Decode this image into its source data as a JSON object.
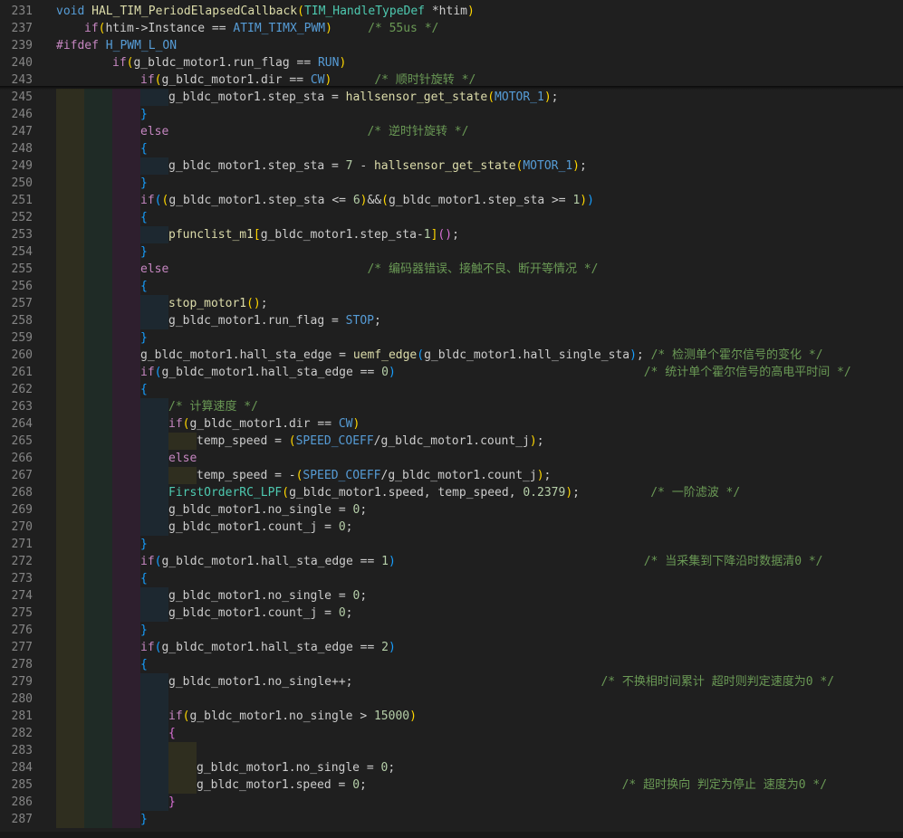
{
  "editor": {
    "language": "C",
    "tokens": [
      {
        "k": "kw",
        "n": "keyword"
      },
      {
        "k": "ctl",
        "n": "control-keyword"
      },
      {
        "k": "typ",
        "n": "type-name"
      },
      {
        "k": "mac",
        "n": "macro"
      },
      {
        "k": "fn",
        "n": "function"
      },
      {
        "k": "num",
        "n": "number"
      },
      {
        "k": "cm",
        "n": "comment"
      },
      {
        "k": "br1",
        "n": "bracket-gold"
      },
      {
        "k": "br2",
        "n": "bracket-purple"
      },
      {
        "k": "br3",
        "n": "bracket-blue"
      }
    ],
    "colors": {
      "background": "#1f1f1f",
      "keyword": "#569cd6",
      "control": "#c586c0",
      "type": "#4ec9b0",
      "function": "#dcdcaa",
      "number": "#b5cea8",
      "comment": "#6a9955",
      "line_number": "#858585"
    },
    "sticky_lines": [
      {
        "num": "231",
        "indent": 0,
        "parts": [
          [
            "kw",
            "void"
          ],
          [
            "txt",
            " "
          ],
          [
            "fn",
            "HAL_TIM_PeriodElapsedCallback"
          ],
          [
            "br1",
            "("
          ],
          [
            "typ",
            "TIM_HandleTypeDef"
          ],
          [
            "txt",
            " *htim"
          ],
          [
            "br1",
            ")"
          ]
        ]
      },
      {
        "num": "237",
        "indent": 1,
        "parts": [
          [
            "ctl",
            "if"
          ],
          [
            "br1",
            "("
          ],
          [
            "txt",
            "htim->Instance == "
          ],
          [
            "mac",
            "ATIM_TIMX_PWM"
          ],
          [
            "br1",
            ")"
          ],
          [
            "txt",
            "     "
          ],
          [
            "cm",
            "/* 55us */"
          ]
        ]
      },
      {
        "num": "239",
        "indent": 0,
        "parts": [
          [
            "ctl",
            "#ifdef"
          ],
          [
            "txt",
            " "
          ],
          [
            "mac",
            "H_PWM_L_ON"
          ]
        ]
      },
      {
        "num": "240",
        "indent": 2,
        "parts": [
          [
            "ctl",
            "if"
          ],
          [
            "br1",
            "("
          ],
          [
            "txt",
            "g_bldc_motor1.run_flag == "
          ],
          [
            "mac",
            "RUN"
          ],
          [
            "br1",
            ")"
          ]
        ]
      },
      {
        "num": "243",
        "indent": 3,
        "parts": [
          [
            "ctl",
            "if"
          ],
          [
            "br1",
            "("
          ],
          [
            "txt",
            "g_bldc_motor1.dir == "
          ],
          [
            "mac",
            "CW"
          ],
          [
            "br1",
            ")"
          ],
          [
            "txt",
            "      "
          ],
          [
            "cm",
            "/* 顺时针旋转 */"
          ]
        ]
      }
    ],
    "lines": [
      {
        "num": "245",
        "indent": 4,
        "parts": [
          [
            "txt",
            "g_bldc_motor1.step_sta = "
          ],
          [
            "fn",
            "hallsensor_get_state"
          ],
          [
            "br1",
            "("
          ],
          [
            "mac",
            "MOTOR_1"
          ],
          [
            "br1",
            ")"
          ],
          [
            "txt",
            ";"
          ]
        ]
      },
      {
        "num": "246",
        "indent": 3,
        "parts": [
          [
            "br3",
            "}"
          ]
        ]
      },
      {
        "num": "247",
        "indent": 3,
        "parts": [
          [
            "ctl",
            "else"
          ],
          [
            "txt",
            "                            "
          ],
          [
            "cm",
            "/* 逆时针旋转 */"
          ]
        ]
      },
      {
        "num": "248",
        "indent": 3,
        "parts": [
          [
            "br3",
            "{"
          ]
        ]
      },
      {
        "num": "249",
        "indent": 4,
        "parts": [
          [
            "txt",
            "g_bldc_motor1.step_sta = "
          ],
          [
            "num",
            "7"
          ],
          [
            "txt",
            " - "
          ],
          [
            "fn",
            "hallsensor_get_state"
          ],
          [
            "br1",
            "("
          ],
          [
            "mac",
            "MOTOR_1"
          ],
          [
            "br1",
            ")"
          ],
          [
            "txt",
            ";"
          ]
        ]
      },
      {
        "num": "250",
        "indent": 3,
        "parts": [
          [
            "br3",
            "}"
          ]
        ]
      },
      {
        "num": "251",
        "indent": 3,
        "parts": [
          [
            "ctl",
            "if"
          ],
          [
            "br3",
            "("
          ],
          [
            "br1",
            "("
          ],
          [
            "txt",
            "g_bldc_motor1.step_sta <= "
          ],
          [
            "num",
            "6"
          ],
          [
            "br1",
            ")"
          ],
          [
            "txt",
            "&&"
          ],
          [
            "br1",
            "("
          ],
          [
            "txt",
            "g_bldc_motor1.step_sta >= "
          ],
          [
            "num",
            "1"
          ],
          [
            "br1",
            ")"
          ],
          [
            "br3",
            ")"
          ]
        ]
      },
      {
        "num": "252",
        "indent": 3,
        "parts": [
          [
            "br3",
            "{"
          ]
        ]
      },
      {
        "num": "253",
        "indent": 4,
        "parts": [
          [
            "fn",
            "pfunclist_m1"
          ],
          [
            "br1",
            "["
          ],
          [
            "txt",
            "g_bldc_motor1.step_sta-"
          ],
          [
            "num",
            "1"
          ],
          [
            "br1",
            "]"
          ],
          [
            "br2",
            "()"
          ],
          [
            "txt",
            ";"
          ]
        ]
      },
      {
        "num": "254",
        "indent": 3,
        "parts": [
          [
            "br3",
            "}"
          ]
        ]
      },
      {
        "num": "255",
        "indent": 3,
        "parts": [
          [
            "ctl",
            "else"
          ],
          [
            "txt",
            "                            "
          ],
          [
            "cm",
            "/* 编码器错误、接触不良、断开等情况 */"
          ]
        ]
      },
      {
        "num": "256",
        "indent": 3,
        "parts": [
          [
            "br3",
            "{"
          ]
        ]
      },
      {
        "num": "257",
        "indent": 4,
        "parts": [
          [
            "fn",
            "stop_motor1"
          ],
          [
            "br1",
            "()"
          ],
          [
            "txt",
            ";"
          ]
        ]
      },
      {
        "num": "258",
        "indent": 4,
        "parts": [
          [
            "txt",
            "g_bldc_motor1.run_flag = "
          ],
          [
            "mac",
            "STOP"
          ],
          [
            "txt",
            ";"
          ]
        ]
      },
      {
        "num": "259",
        "indent": 3,
        "parts": [
          [
            "br3",
            "}"
          ]
        ]
      },
      {
        "num": "260",
        "indent": 3,
        "parts": [
          [
            "txt",
            "g_bldc_motor1.hall_sta_edge = "
          ],
          [
            "fn",
            "uemf_edge"
          ],
          [
            "br3",
            "("
          ],
          [
            "txt",
            "g_bldc_motor1.hall_single_sta"
          ],
          [
            "br3",
            ")"
          ],
          [
            "txt",
            "; "
          ],
          [
            "cm",
            "/* 检测单个霍尔信号的变化 */"
          ]
        ]
      },
      {
        "num": "261",
        "indent": 3,
        "parts": [
          [
            "ctl",
            "if"
          ],
          [
            "br3",
            "("
          ],
          [
            "txt",
            "g_bldc_motor1.hall_sta_edge == "
          ],
          [
            "num",
            "0"
          ],
          [
            "br3",
            ")"
          ],
          [
            "txt",
            "                                   "
          ],
          [
            "cm",
            "/* 统计单个霍尔信号的高电平时间 */"
          ]
        ]
      },
      {
        "num": "262",
        "indent": 3,
        "parts": [
          [
            "br3",
            "{"
          ]
        ]
      },
      {
        "num": "263",
        "indent": 4,
        "parts": [
          [
            "cm",
            "/* 计算速度 */"
          ]
        ]
      },
      {
        "num": "264",
        "indent": 4,
        "parts": [
          [
            "ctl",
            "if"
          ],
          [
            "br1",
            "("
          ],
          [
            "txt",
            "g_bldc_motor1.dir == "
          ],
          [
            "mac",
            "CW"
          ],
          [
            "br1",
            ")"
          ]
        ]
      },
      {
        "num": "265",
        "indent": 5,
        "parts": [
          [
            "txt",
            "temp_speed = "
          ],
          [
            "br1",
            "("
          ],
          [
            "mac",
            "SPEED_COEFF"
          ],
          [
            "txt",
            "/g_bldc_motor1.count_j"
          ],
          [
            "br1",
            ")"
          ],
          [
            "txt",
            ";"
          ]
        ]
      },
      {
        "num": "266",
        "indent": 4,
        "parts": [
          [
            "ctl",
            "else"
          ]
        ]
      },
      {
        "num": "267",
        "indent": 5,
        "parts": [
          [
            "txt",
            "temp_speed = -"
          ],
          [
            "br1",
            "("
          ],
          [
            "mac",
            "SPEED_COEFF"
          ],
          [
            "txt",
            "/g_bldc_motor1.count_j"
          ],
          [
            "br1",
            ")"
          ],
          [
            "txt",
            ";"
          ]
        ]
      },
      {
        "num": "268",
        "indent": 4,
        "parts": [
          [
            "typ",
            "FirstOrderRC_LPF"
          ],
          [
            "br1",
            "("
          ],
          [
            "txt",
            "g_bldc_motor1.speed, temp_speed, "
          ],
          [
            "num",
            "0.2379"
          ],
          [
            "br1",
            ")"
          ],
          [
            "txt",
            ";          "
          ],
          [
            "cm",
            "/* 一阶滤波 */"
          ]
        ]
      },
      {
        "num": "269",
        "indent": 4,
        "parts": [
          [
            "txt",
            "g_bldc_motor1.no_single = "
          ],
          [
            "num",
            "0"
          ],
          [
            "txt",
            ";"
          ]
        ]
      },
      {
        "num": "270",
        "indent": 4,
        "parts": [
          [
            "txt",
            "g_bldc_motor1.count_j = "
          ],
          [
            "num",
            "0"
          ],
          [
            "txt",
            ";"
          ]
        ]
      },
      {
        "num": "271",
        "indent": 3,
        "parts": [
          [
            "br3",
            "}"
          ]
        ]
      },
      {
        "num": "272",
        "indent": 3,
        "parts": [
          [
            "ctl",
            "if"
          ],
          [
            "br3",
            "("
          ],
          [
            "txt",
            "g_bldc_motor1.hall_sta_edge == "
          ],
          [
            "num",
            "1"
          ],
          [
            "br3",
            ")"
          ],
          [
            "txt",
            "                                   "
          ],
          [
            "cm",
            "/* 当采集到下降沿时数据清0 */"
          ]
        ]
      },
      {
        "num": "273",
        "indent": 3,
        "parts": [
          [
            "br3",
            "{"
          ]
        ]
      },
      {
        "num": "274",
        "indent": 4,
        "parts": [
          [
            "txt",
            "g_bldc_motor1.no_single = "
          ],
          [
            "num",
            "0"
          ],
          [
            "txt",
            ";"
          ]
        ]
      },
      {
        "num": "275",
        "indent": 4,
        "parts": [
          [
            "txt",
            "g_bldc_motor1.count_j = "
          ],
          [
            "num",
            "0"
          ],
          [
            "txt",
            ";"
          ]
        ]
      },
      {
        "num": "276",
        "indent": 3,
        "parts": [
          [
            "br3",
            "}"
          ]
        ]
      },
      {
        "num": "277",
        "indent": 3,
        "parts": [
          [
            "ctl",
            "if"
          ],
          [
            "br3",
            "("
          ],
          [
            "txt",
            "g_bldc_motor1.hall_sta_edge == "
          ],
          [
            "num",
            "2"
          ],
          [
            "br3",
            ")"
          ]
        ]
      },
      {
        "num": "278",
        "indent": 3,
        "parts": [
          [
            "br3",
            "{"
          ]
        ]
      },
      {
        "num": "279",
        "indent": 4,
        "parts": [
          [
            "txt",
            "g_bldc_motor1.no_single++;                                   "
          ],
          [
            "cm",
            "/* 不换相时间累计 超时则判定速度为0 */"
          ]
        ]
      },
      {
        "num": "280",
        "indent": 4,
        "parts": []
      },
      {
        "num": "281",
        "indent": 4,
        "parts": [
          [
            "ctl",
            "if"
          ],
          [
            "br1",
            "("
          ],
          [
            "txt",
            "g_bldc_motor1.no_single > "
          ],
          [
            "num",
            "15000"
          ],
          [
            "br1",
            ")"
          ]
        ]
      },
      {
        "num": "282",
        "indent": 4,
        "parts": [
          [
            "br2",
            "{"
          ]
        ]
      },
      {
        "num": "283",
        "indent": 5,
        "parts": []
      },
      {
        "num": "284",
        "indent": 5,
        "parts": [
          [
            "txt",
            "g_bldc_motor1.no_single = "
          ],
          [
            "num",
            "0"
          ],
          [
            "txt",
            ";"
          ]
        ]
      },
      {
        "num": "285",
        "indent": 5,
        "parts": [
          [
            "txt",
            "g_bldc_motor1.speed = "
          ],
          [
            "num",
            "0"
          ],
          [
            "txt",
            ";                                    "
          ],
          [
            "cm",
            "/* 超时换向 判定为停止 速度为0 */"
          ]
        ]
      },
      {
        "num": "286",
        "indent": 4,
        "parts": [
          [
            "br2",
            "}"
          ]
        ]
      },
      {
        "num": "287",
        "indent": 3,
        "parts": [
          [
            "br3",
            "}"
          ]
        ]
      }
    ]
  }
}
